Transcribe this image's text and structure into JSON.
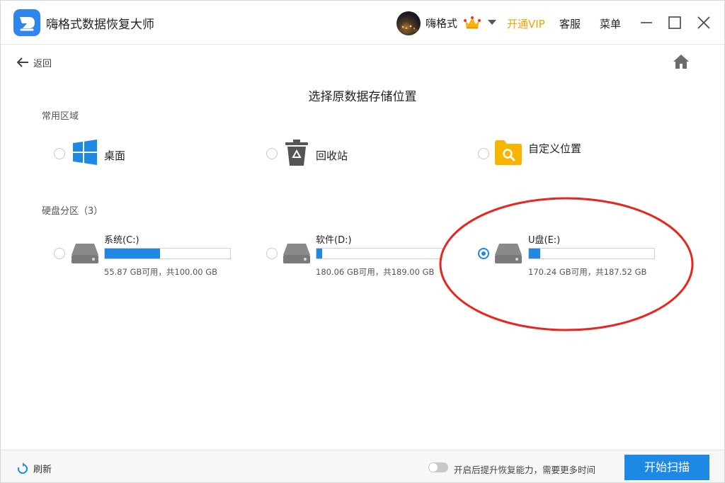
{
  "app": {
    "title": "嗨格式数据恢复大师",
    "user_name": "嗨格式",
    "vip_label": "开通VIP",
    "service_label": "客服",
    "menu_label": "菜单"
  },
  "nav": {
    "back_label": "返回"
  },
  "page": {
    "title": "选择原数据存储位置"
  },
  "common": {
    "section_label": "常用区域",
    "items": [
      {
        "label": "桌面",
        "icon": "windows-desktop-icon",
        "selected": false
      },
      {
        "label": "回收站",
        "icon": "recycle-bin-icon",
        "selected": false
      },
      {
        "label": "自定义位置",
        "icon": "folder-search-icon",
        "selected": false
      }
    ]
  },
  "disks": {
    "section_label": "硬盘分区（3）",
    "items": [
      {
        "name": "系统(C:)",
        "info": "55.87 GB可用，共100.00 GB",
        "used_fraction": 0.44,
        "selected": false
      },
      {
        "name": "软件(D:)",
        "info": "180.06 GB可用，共189.00 GB",
        "used_fraction": 0.047,
        "selected": false
      },
      {
        "name": "U盘(E:)",
        "info": "170.24 GB可用，共187.52 GB",
        "used_fraction": 0.09,
        "selected": true
      }
    ]
  },
  "footer": {
    "refresh_label": "刷新",
    "toggle_label": "开启后提升恢复能力，需要更多时间",
    "toggle_on": false,
    "scan_label": "开始扫描"
  },
  "colors": {
    "accent": "#1e88e5",
    "vip": "#f0a30a",
    "highlight": "#e8251f"
  }
}
